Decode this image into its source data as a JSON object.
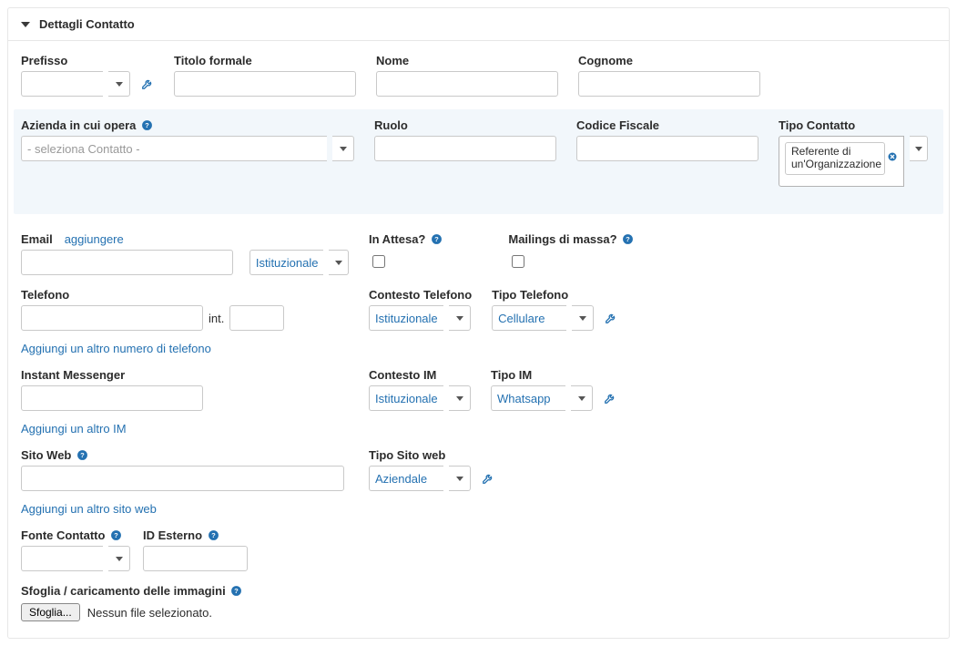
{
  "section": {
    "title": "Dettagli Contatto"
  },
  "labels": {
    "prefisso": "Prefisso",
    "titolo_formale": "Titolo formale",
    "nome": "Nome",
    "cognome": "Cognome",
    "azienda": "Azienda in cui opera",
    "ruolo": "Ruolo",
    "codice_fiscale": "Codice Fiscale",
    "tipo_contatto": "Tipo Contatto",
    "email": "Email",
    "aggiungere": "aggiungere",
    "istituzionale": "Istituzionale",
    "in_attesa": "In Attesa?",
    "mailings": "Mailings di massa?",
    "telefono": "Telefono",
    "int": "int.",
    "contesto_telefono": "Contesto Telefono",
    "tipo_telefono": "Tipo Telefono",
    "cellulare": "Cellulare",
    "add_phone": "Aggiungi un altro numero di telefono",
    "im": "Instant Messenger",
    "contesto_im": "Contesto IM",
    "tipo_im": "Tipo IM",
    "whatsapp": "Whatsapp",
    "add_im": "Aggiungi un altro IM",
    "sito_web": "Sito Web",
    "tipo_sito": "Tipo Sito web",
    "aziendale": "Aziendale",
    "add_site": "Aggiungi un altro sito web",
    "fonte_contatto": "Fonte Contatto",
    "id_esterno": "ID Esterno",
    "upload_title": "Sfoglia / caricamento delle immagini",
    "sfoglia": "Sfoglia...",
    "no_file": "Nessun file selezionato.",
    "azienda_placeholder": "- seleziona Contatto -",
    "tipo_contatto_tag": "Referente di un'Organizzazione"
  }
}
